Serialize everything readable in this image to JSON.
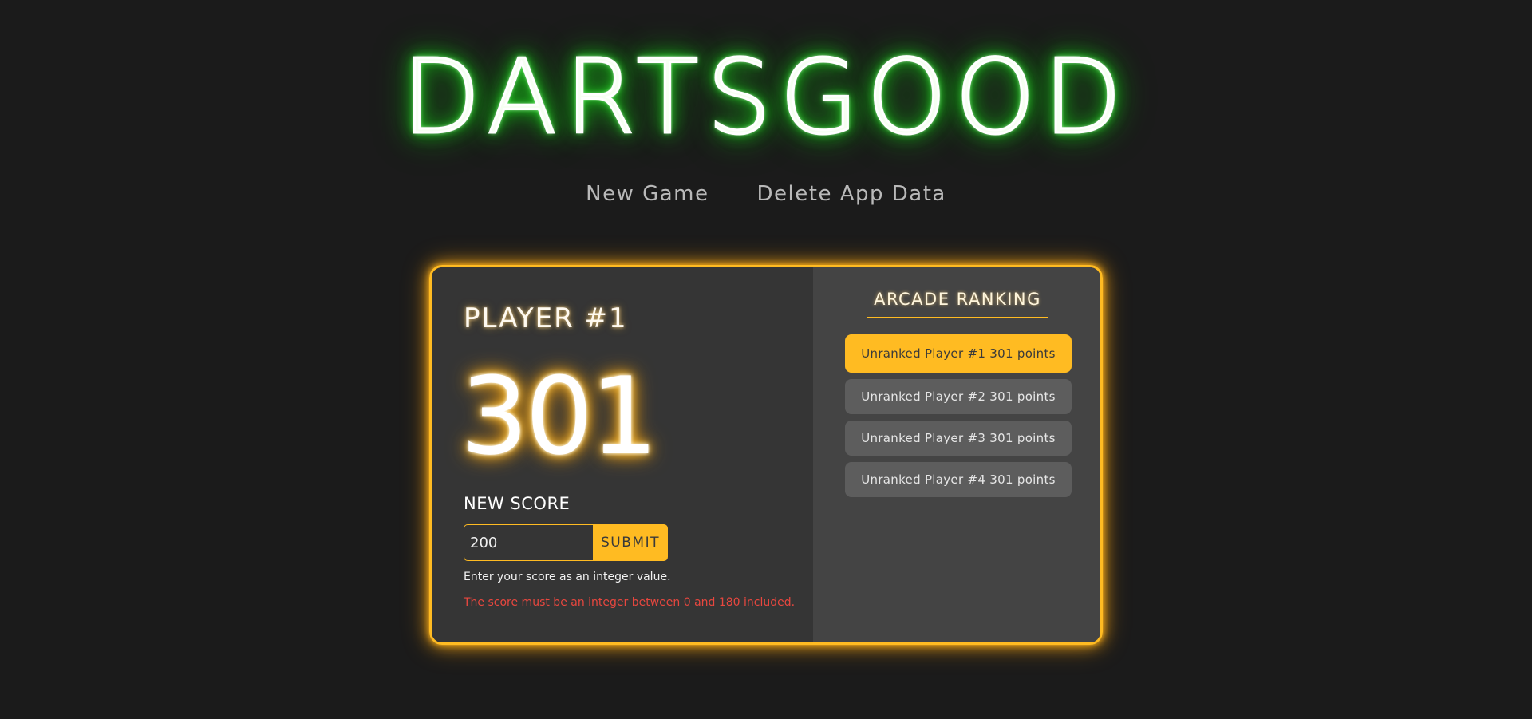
{
  "app": {
    "title": "DARTSGOOD"
  },
  "nav": {
    "new_game": "New Game",
    "delete_data": "Delete App Data"
  },
  "player": {
    "name": "PLAYER #1",
    "score": "301"
  },
  "form": {
    "label": "NEW SCORE",
    "input_value": "200",
    "submit_label": "SUBMIT",
    "hint": "Enter your score as an integer value.",
    "error": "The score must be an integer between 0 and 180 included."
  },
  "ranking": {
    "title": "ARCADE RANKING",
    "items": [
      {
        "label": "Unranked Player #1 301 points",
        "active": true
      },
      {
        "label": "Unranked Player #2 301 points",
        "active": false
      },
      {
        "label": "Unranked Player #3 301 points",
        "active": false
      },
      {
        "label": "Unranked Player #4 301 points",
        "active": false
      }
    ]
  },
  "colors": {
    "background": "#1b1b1b",
    "neon_green": "#1fe61f",
    "accent": "#ffbb22",
    "error": "#e8473f",
    "left_panel": "#353535",
    "right_panel": "#444444"
  }
}
